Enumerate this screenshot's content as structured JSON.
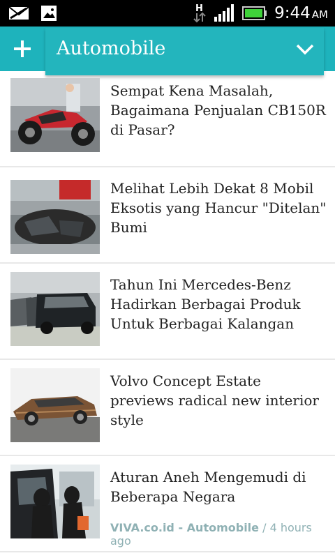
{
  "status_bar": {
    "time": "9:44",
    "ampm": "AM",
    "network": "H",
    "icons": [
      "mail-icon",
      "image-icon",
      "network-h-icon",
      "signal-icon",
      "battery-icon"
    ]
  },
  "app_bar": {
    "add_icon": "plus-icon",
    "category": "Automobile",
    "dropdown_icon": "chevron-down-icon",
    "background": "#1eb3bc"
  },
  "articles": [
    {
      "title": "Sempat Kena Masalah, Bagaimana Penjualan CB150R di Pasar?",
      "thumb": "motorcycle"
    },
    {
      "title": "Melihat Lebih Dekat 8 Mobil Eksotis yang Hancur \"Ditelan\" Bumi",
      "thumb": "sinkhole"
    },
    {
      "title": "Tahun Ini Mercedes-Benz Hadirkan Berbagai Produk Untuk Berbagai Kalangan",
      "thumb": "mercedes"
    },
    {
      "title": "Volvo Concept Estate previews radical new interior style",
      "thumb": "volvo"
    },
    {
      "title": "Aturan Aneh Mengemudi di Beberapa Negara",
      "thumb": "women-car",
      "source": "VIVA.co.id - Automobile",
      "separator": "/",
      "age": "4 hours ago"
    }
  ],
  "colors": {
    "accent": "#1eb3bc",
    "meta_text": "#8fb1b4",
    "divider": "#e8e8e8"
  }
}
